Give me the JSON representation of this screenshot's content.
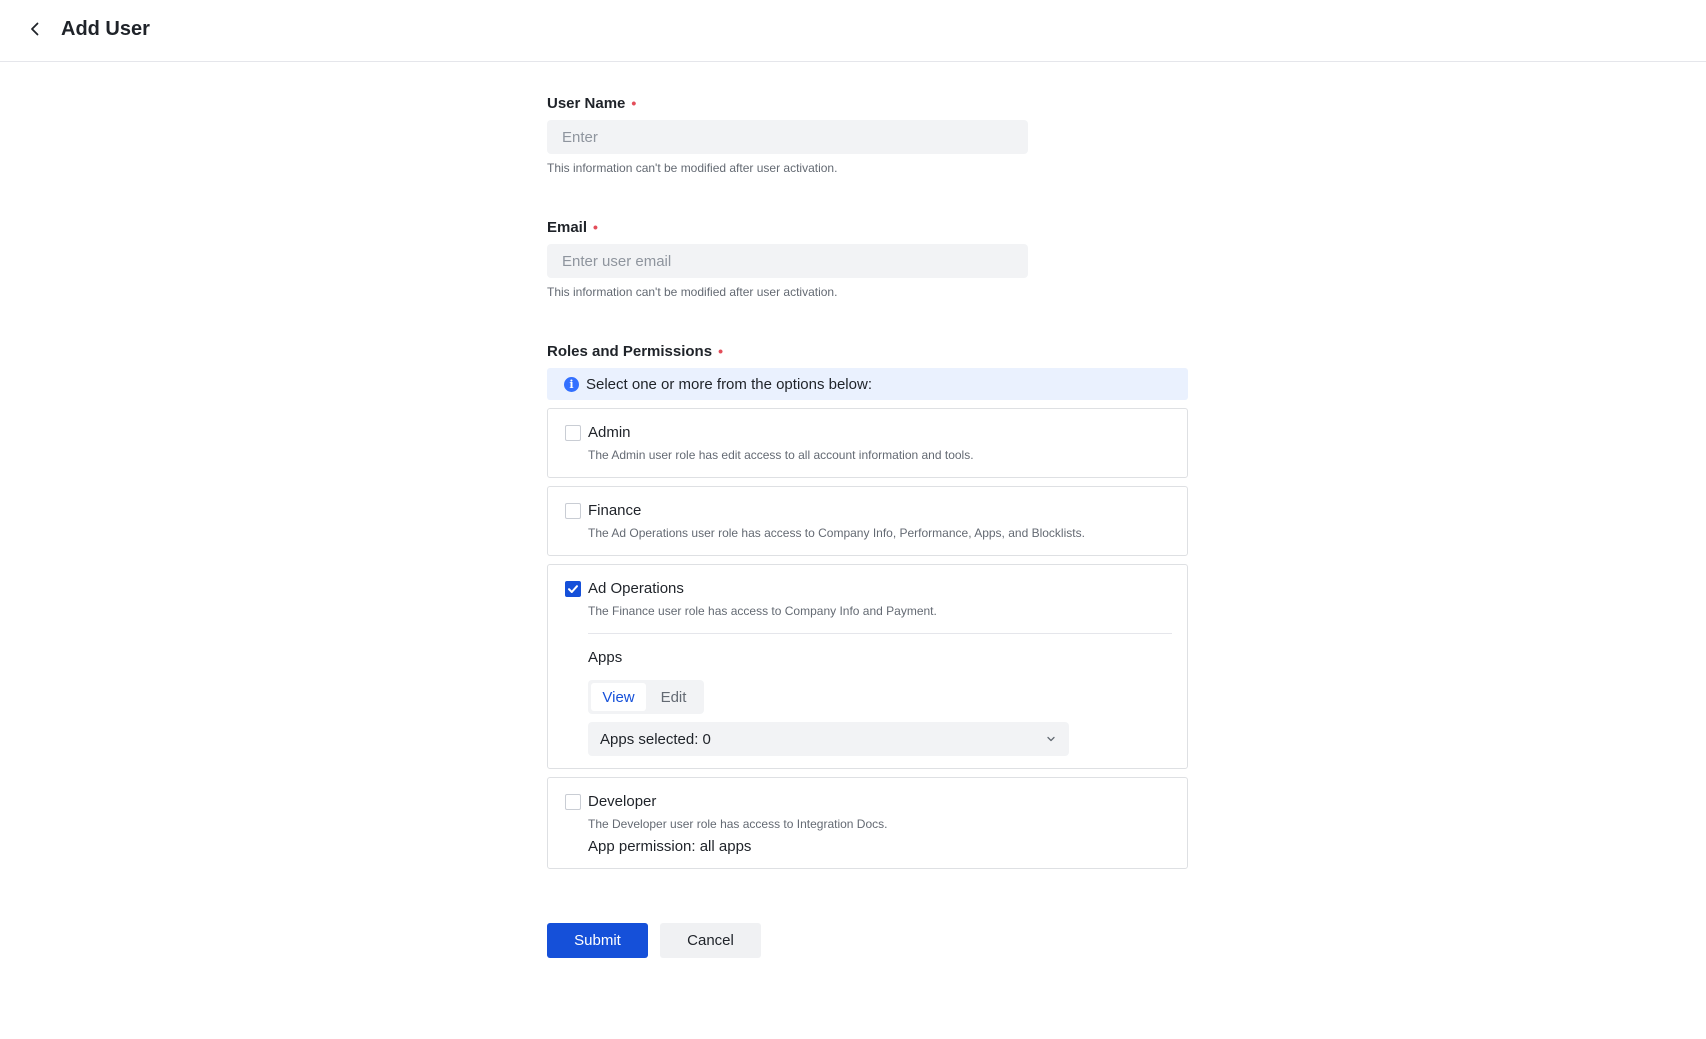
{
  "header": {
    "title": "Add User"
  },
  "form": {
    "username": {
      "label": "User Name",
      "required_mark": "•",
      "placeholder": "Enter",
      "value": "",
      "hint": "This information can't be modified after user activation."
    },
    "email": {
      "label": "Email",
      "required_mark": "•",
      "placeholder": "Enter user email",
      "value": "",
      "hint": "This information can't be modified after user activation."
    },
    "roles": {
      "label": "Roles and Permissions",
      "required_mark": "•",
      "info_icon": "info-icon",
      "info": "Select one or more from the options below:",
      "items": [
        {
          "title": "Admin",
          "checked": false,
          "description": "The Admin user role has edit access to all account information and tools."
        },
        {
          "title": "Finance",
          "checked": false,
          "description": "The Ad Operations user role has access to Company Info, Performance, Apps, and Blocklists."
        },
        {
          "title": "Ad Operations",
          "checked": true,
          "description": "The Finance user role has access to Company Info and Payment.",
          "apps": {
            "label": "Apps",
            "modes": [
              "View",
              "Edit"
            ],
            "active_mode": "View",
            "select_value": "Apps selected: 0"
          }
        },
        {
          "title": "Developer",
          "checked": false,
          "description": "The Developer user role has access to Integration Docs.",
          "permission": "App permission: all apps"
        }
      ]
    }
  },
  "actions": {
    "submit": "Submit",
    "cancel": "Cancel"
  },
  "colors": {
    "primary": "#1550d9",
    "required": "#e34d59",
    "info_bg": "#eaf1fe",
    "input_bg": "#f2f3f5"
  }
}
